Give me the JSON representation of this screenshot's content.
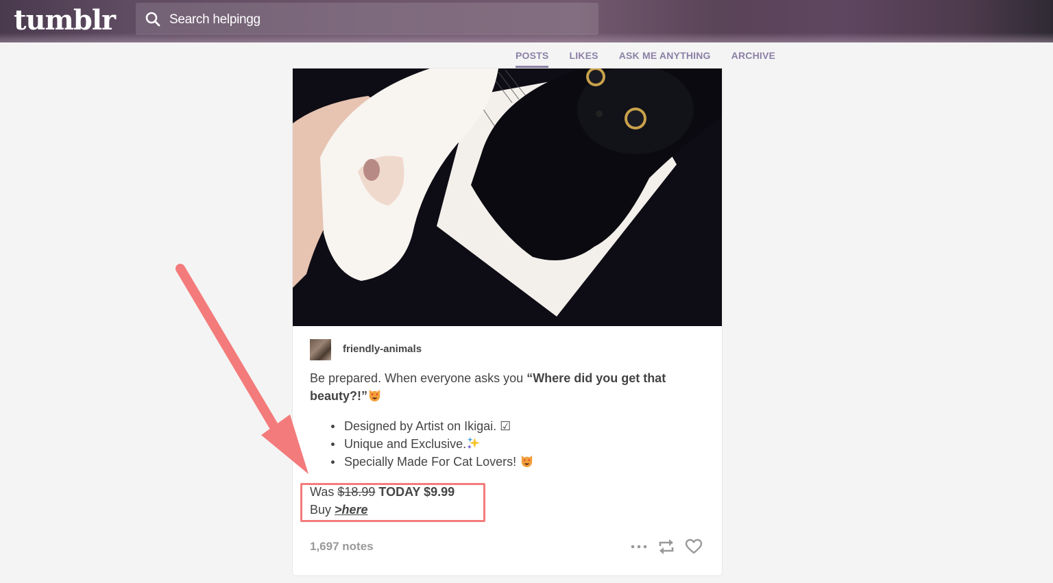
{
  "header": {
    "logo": "tumblr",
    "search_placeholder": "Search helpingg",
    "search_icon": "search-icon"
  },
  "nav": {
    "items": [
      {
        "label": "POSTS",
        "active": true
      },
      {
        "label": "LIKES",
        "active": false
      },
      {
        "label": "ASK ME ANYTHING",
        "active": false
      },
      {
        "label": "ARCHIVE",
        "active": false
      }
    ]
  },
  "post": {
    "image_description": "Fluffy white and black cat-face plush phone cases on a dark background with a book page",
    "blog_name": "friendly-animals",
    "caption": {
      "intro": "Be prepared. When everyone asks you ",
      "bold_quote": "“Where did you get that beauty?!”",
      "emoji": "heart-eyes-cat"
    },
    "bullets": [
      {
        "text": "Designed by Artist on Ikigai. ",
        "suffix": "☑"
      },
      {
        "text": "Unique and Exclusive.",
        "suffix_icon": "sparkles-icon"
      },
      {
        "text": "Specially Made For Cat Lovers! ",
        "suffix_icon": "heart-eyes-cat-icon"
      }
    ],
    "price": {
      "was_label": "Was ",
      "old_price": "$18.99",
      "today_label": " TODAY $9.99"
    },
    "buy": {
      "label": "Buy ",
      "link_text": ">here"
    },
    "notes": "1,697 notes",
    "actions": [
      "more-icon",
      "reblog-icon",
      "like-icon"
    ]
  },
  "annotation": {
    "color": "#f47b7b",
    "type": "arrow-and-highlight-box"
  },
  "colors": {
    "nav_accent": "#8b80a6",
    "text": "#444444",
    "notes": "#999999",
    "annotation": "#f47b7b"
  }
}
